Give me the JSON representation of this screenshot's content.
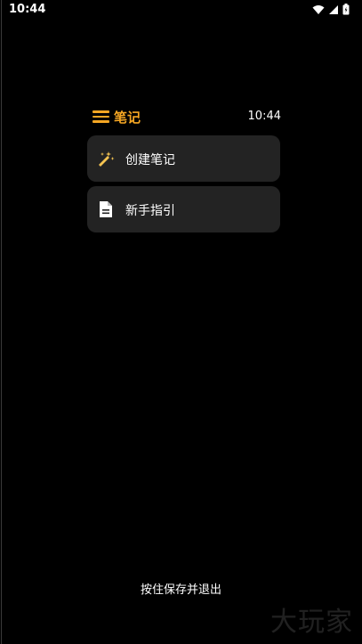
{
  "status_bar": {
    "time": "10:44",
    "icons": [
      "wifi-icon",
      "signal-icon",
      "battery-icon"
    ]
  },
  "header": {
    "title": "笔记",
    "time": "10:44",
    "menu_icon": "menu-icon"
  },
  "menu": {
    "items": [
      {
        "label": "创建笔记",
        "icon": "magic-wand-icon"
      },
      {
        "label": "新手指引",
        "icon": "document-icon"
      }
    ]
  },
  "footer": {
    "hint": "按住保存并退出"
  },
  "watermark": {
    "text": "大玩家"
  },
  "colors": {
    "accent": "#f5a623",
    "card_background": "#232323",
    "background": "#000000",
    "text": "#ffffff"
  }
}
